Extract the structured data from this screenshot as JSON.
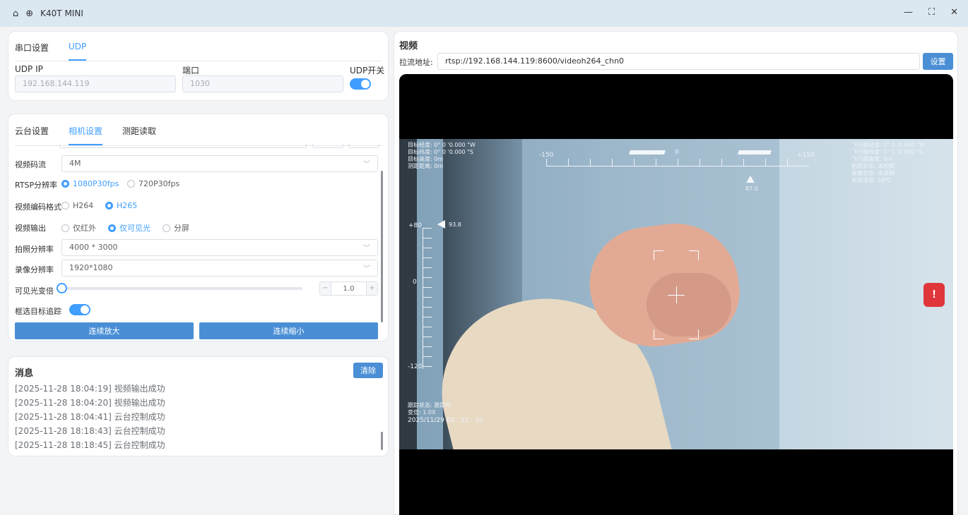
{
  "app": {
    "title": "K40T MINI",
    "home_icon": "home-icon",
    "globe_icon": "globe-icon"
  },
  "window": {
    "minimize": "—",
    "maximize": "⛶",
    "close": "✕"
  },
  "udp_panel": {
    "tabs": [
      "串口设置",
      "UDP"
    ],
    "active_tab": 1,
    "ip_label": "UDP IP",
    "ip_value": "192.168.144.119",
    "port_label": "端口",
    "port_value": "1030",
    "switch_label": "UDP开关",
    "switch_on": true
  },
  "camera_panel": {
    "tabs": [
      "云台设置",
      "相机设置",
      "测距读取"
    ],
    "active_tab": 1,
    "bitrate_label": "视频码流",
    "bitrate_value": "4M",
    "rtsp_label": "RTSP分辨率",
    "rtsp_options": [
      "1080P30fps",
      "720P30fps"
    ],
    "rtsp_selected": 0,
    "codec_label": "视频编码格式",
    "codec_options": [
      "H264",
      "H265"
    ],
    "codec_selected": 1,
    "output_label": "视频输出",
    "output_options": [
      "仅红外",
      "仅可见光",
      "分屏"
    ],
    "output_selected": 1,
    "photo_res_label": "拍照分辨率",
    "photo_res_value": "4000 * 3000",
    "record_res_label": "录像分辨率",
    "record_res_value": "1920*1080",
    "zoom_label": "可见光变倍",
    "zoom_value": "1.0",
    "zoom_minus": "−",
    "zoom_plus": "+",
    "track_label": "框选目标追踪",
    "track_on": true,
    "zoom_in_button": "连续放大",
    "zoom_out_button": "连续缩小"
  },
  "messages": {
    "title": "消息",
    "clear_button": "清除",
    "items": [
      "[2025-11-28 18:04:19] 视频输出成功",
      "[2025-11-28 18:04:20] 视频输出成功",
      "[2025-11-28 18:04:41] 云台控制成功",
      "[2025-11-28 18:18:43] 云台控制成功",
      "[2025-11-28 18:18:45] 云台控制成功"
    ]
  },
  "video": {
    "title": "视频",
    "url_label": "拉流地址:",
    "url_value": "rtsp://192.168.144.119:8600/videoh264_chn0",
    "set_button": "设置",
    "hud": {
      "target_lon": "目标经度: 0°  0 '0.000 \"W",
      "target_lat": "目标纬度: 0°  0 '0.000 \"S",
      "target_alt": "目标高度: 0m",
      "range": "测距距离: 0m",
      "heading_min": "-150",
      "heading_zero": "0",
      "heading_max": "+150",
      "heading_value": "87.0",
      "pitch_top": "+80",
      "pitch_zero": "0",
      "pitch_bottom": "-120",
      "pitch_value": "93.8",
      "fly_lon": "飞行器经度: 0°  0 '0.000 \"W",
      "fly_lat": "飞行器纬度: 0°  0 '0.000 \"S",
      "fly_alt": "飞行器高度: 0m",
      "photo_state": "拍照状态: 未拍照",
      "record_state": "录像状态: 未录制",
      "sys_temp": "系统温度: 58℃",
      "track_state": "跟踪状态: 跟踪中",
      "zoom": "变倍: 1.0X",
      "datetime": "2025/11/29 02 : 22 : 10",
      "alert": "!"
    }
  },
  "colors": {
    "accent": "#409eff",
    "button": "#4a8fd6",
    "alert": "#e0353b"
  }
}
